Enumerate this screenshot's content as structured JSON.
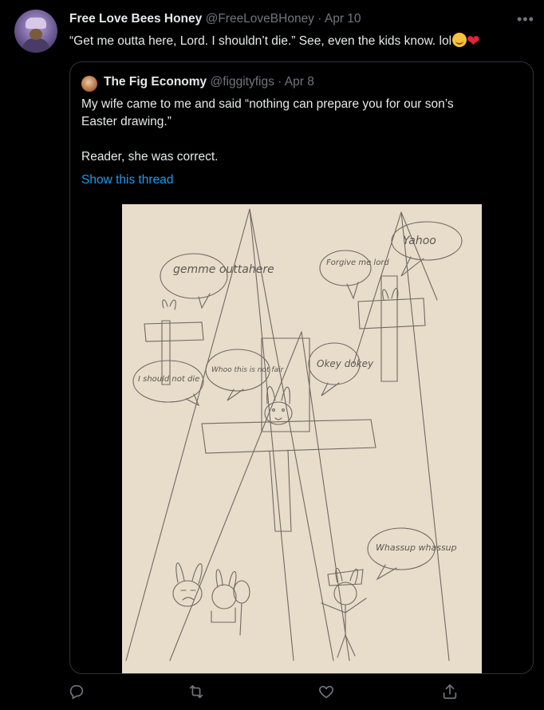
{
  "tweet": {
    "author_name": "Free Love Bees Honey",
    "author_handle": "@FreeLoveBHoney",
    "separator": "·",
    "date": "Apr 10",
    "text": "“Get me outta here, Lord. I shouldn’t die.” See, even the kids know. lol",
    "more_icon": "more-icon",
    "emoji": [
      "relieved-face-emoji",
      "red-heart-emoji"
    ]
  },
  "quote": {
    "author_name": "The Fig Economy",
    "author_handle": "@figgityfigs",
    "separator": "·",
    "date": "Apr 8",
    "lines": [
      "My wife came to me and said “nothing can prepare you for our son’s",
      "Easter drawing.”",
      "Reader, she was correct."
    ],
    "show_thread": "Show this thread",
    "image_alt": "child's pencil drawing"
  },
  "drawing_text": {
    "bubble_1": "gemme outtahere",
    "bubble_2": "Forgive me lord",
    "bubble_3": "Yahoo",
    "bubble_4": "I should not die",
    "bubble_5": "Whoo this is not fair",
    "bubble_6": "Okey dokey",
    "bubble_7": "Whassup whassup"
  },
  "actions": [
    {
      "name": "reply",
      "icon": "reply-icon"
    },
    {
      "name": "retweet",
      "icon": "retweet-icon"
    },
    {
      "name": "like",
      "icon": "heart-icon"
    },
    {
      "name": "share",
      "icon": "share-icon"
    }
  ],
  "colors": {
    "background": "#000000",
    "text": "#e7e9ea",
    "muted": "#71767b",
    "link": "#1d9bf0",
    "border": "#2f3336"
  }
}
